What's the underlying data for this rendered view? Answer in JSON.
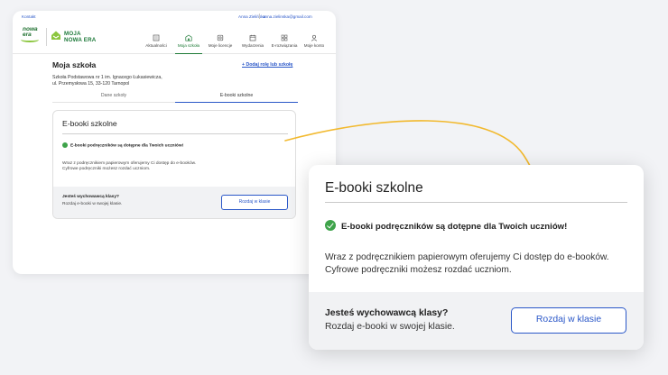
{
  "topbar": {
    "contact": "Kontakt",
    "user_name": "Anna Zielińska",
    "user_email": "anna.zielinska@gmail.com"
  },
  "logo": {
    "nowa_era_line1": "nowa",
    "nowa_era_line2": "era",
    "moja_line1": "MOJA",
    "moja_line2": "NOWA ERA"
  },
  "nav": [
    {
      "label": "Aktualności",
      "icon": "news-icon"
    },
    {
      "label": "Moja szkoła",
      "icon": "school-icon"
    },
    {
      "label": "Moje licencje",
      "icon": "license-icon"
    },
    {
      "label": "Wydarzenia",
      "icon": "calendar-icon"
    },
    {
      "label": "E-rozwiązania",
      "icon": "grid-icon"
    },
    {
      "label": "Moje konto",
      "icon": "user-icon"
    }
  ],
  "page": {
    "title": "Moja szkoła",
    "add_role_link": "+ Dodaj rolę lub szkołę",
    "school_line1": "Szkoła Podstawowa nr 1 im. Ignacego Łukasiewicza,",
    "school_line2": "ul. Przemysłowa 15, 33-120 Tarnopol",
    "tabs": [
      "Dane szkoły",
      "E-booki szkolne"
    ],
    "active_tab": 1
  },
  "card": {
    "title": "E-booki szkolne",
    "success_message": "E-booki podręczników są dotępne dla Twoich uczniów!",
    "desc_line1": "Wraz z podręcznikiem papierowym oferujemy Ci dostęp do e-booków.",
    "desc_line2": "Cyfrowe podręczniki możesz rozdać uczniom.",
    "question": "Jesteś wychowawcą klasy?",
    "answer": "Rozdaj e-booki w swojej klasie.",
    "button": "Rozdaj w klasie"
  },
  "colors": {
    "accent_blue": "#2a57c8",
    "brand_green": "#1d7a36",
    "success_green": "#3ea34a",
    "arrow_yellow": "#f2b92e"
  }
}
